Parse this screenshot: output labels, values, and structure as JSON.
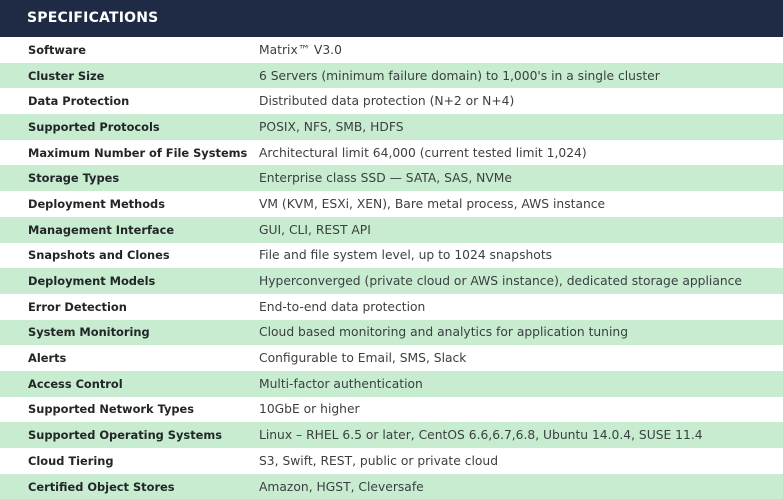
{
  "header": {
    "title": "SPECIFICATIONS"
  },
  "rows": [
    {
      "label": "Software",
      "value": "Matrix™ V3.0"
    },
    {
      "label": "Cluster Size",
      "value": "6 Servers (minimum failure domain) to 1,000's in a single cluster"
    },
    {
      "label": "Data Protection",
      "value": "Distributed data protection  (N+2 or N+4)"
    },
    {
      "label": "Supported Protocols",
      "value": "POSIX, NFS, SMB, HDFS"
    },
    {
      "label": "Maximum Number of File Systems",
      "value": "Architectural limit 64,000 (current tested limit 1,024)"
    },
    {
      "label": "Storage Types",
      "value": "Enterprise class SSD — SATA, SAS, NVMe"
    },
    {
      "label": "Deployment Methods",
      "value": "VM (KVM, ESXi, XEN), Bare metal process, AWS instance"
    },
    {
      "label": "Management Interface",
      "value": "GUI, CLI, REST API"
    },
    {
      "label": "Snapshots and Clones",
      "value": "File and file system level, up to 1024 snapshots"
    },
    {
      "label": "Deployment Models",
      "value": "Hyperconverged (private cloud or AWS instance), dedicated storage appliance"
    },
    {
      "label": "Error Detection",
      "value": "End-to-end data protection"
    },
    {
      "label": "System Monitoring",
      "value": "Cloud based monitoring and analytics for application tuning"
    },
    {
      "label": "Alerts",
      "value": "Configurable to Email, SMS, Slack"
    },
    {
      "label": "Access Control",
      "value": "Multi-factor authentication"
    },
    {
      "label": "Supported Network Types",
      "value": "10GbE or higher"
    },
    {
      "label": "Supported Operating Systems",
      "value": "Linux – RHEL 6.5 or later, CentOS 6.6,6.7,6.8, Ubuntu 14.0.4, SUSE 11.4"
    },
    {
      "label": "Cloud Tiering",
      "value": "S3, Swift, REST, public or private cloud"
    },
    {
      "label": "Certified Object Stores",
      "value": "Amazon, HGST, Cleversafe"
    }
  ],
  "colors": {
    "header_bg": "#1f2b44",
    "header_text": "#ffffff",
    "stripe_green": "#c7eccf",
    "stripe_white": "#ffffff"
  }
}
